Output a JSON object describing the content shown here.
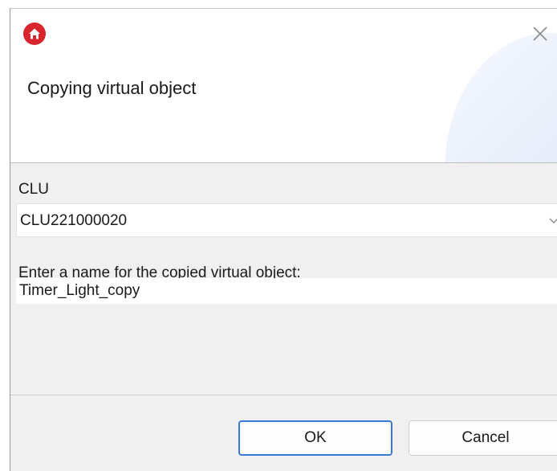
{
  "dialog": {
    "title": "Copying virtual object",
    "icons": {
      "app": "home-icon",
      "close": "close-icon",
      "dropdown": "chevron-down-icon"
    }
  },
  "clu": {
    "label": "CLU",
    "selected": "CLU221000020"
  },
  "name_field": {
    "label": "Enter a name for the copied virtual object:",
    "value": "Timer_Light_copy"
  },
  "buttons": {
    "ok": "OK",
    "cancel": "Cancel"
  },
  "colors": {
    "accent": "#3a78d6",
    "app_icon": "#d9262e"
  }
}
